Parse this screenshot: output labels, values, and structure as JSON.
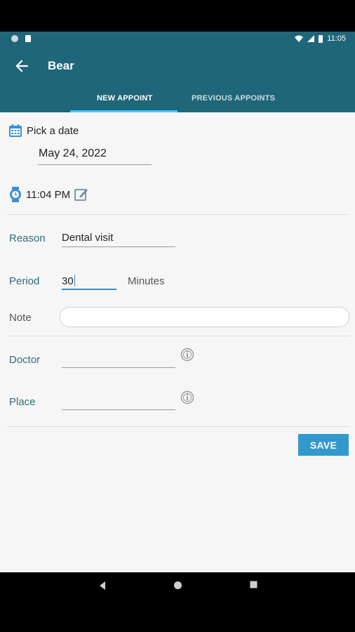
{
  "status_bar": {
    "time": "11:05"
  },
  "app_bar": {
    "title": "Bear"
  },
  "tabs": [
    {
      "label": "NEW APPOINT",
      "active": true
    },
    {
      "label": "PREVIOUS APPOINTS",
      "active": false
    }
  ],
  "form": {
    "date_label": "Pick a date",
    "date_value": "May 24, 2022",
    "time_value": "11:04 PM",
    "reason_label": "Reason",
    "reason_value": "Dental visit",
    "period_label": "Period",
    "period_value": "30",
    "period_unit": "Minutes",
    "note_label": "Note",
    "note_value": "",
    "doctor_label": "Doctor",
    "doctor_value": "",
    "place_label": "Place",
    "place_value": "",
    "save_label": "SAVE"
  },
  "colors": {
    "primary": "#1f6679",
    "accent": "#3399cc",
    "label": "#2e6b7d"
  }
}
